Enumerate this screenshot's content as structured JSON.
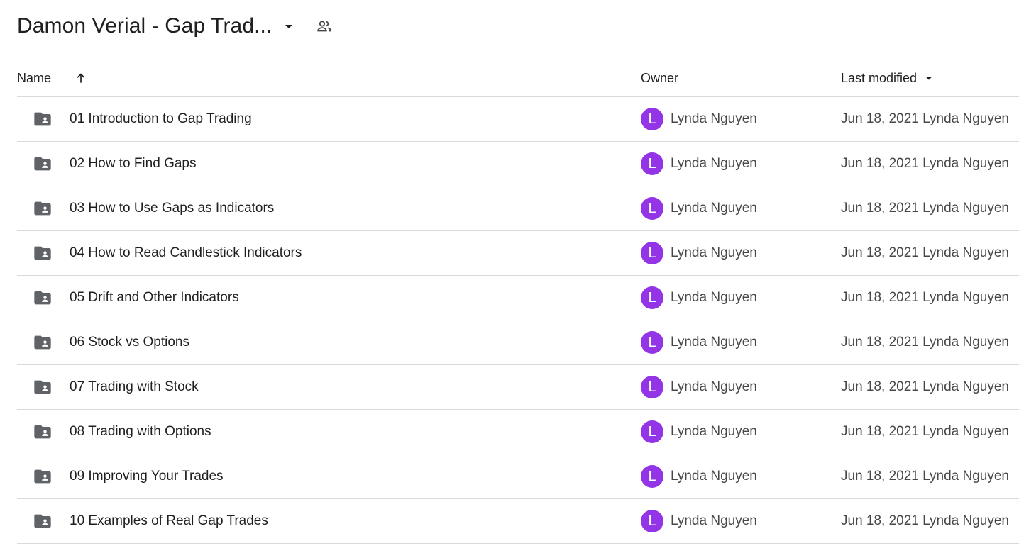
{
  "header": {
    "folder_title": "Damon Verial - Gap Trad...",
    "caret_icon": "arrow-drop-down-icon",
    "shared_icon": "people-icon"
  },
  "columns": {
    "name": "Name",
    "owner": "Owner",
    "last_modified": "Last modified",
    "name_sort": "ascending"
  },
  "colors": {
    "avatar": "#9334e6",
    "folder_icon": "#5f6368",
    "divider": "#dadada"
  },
  "rows": [
    {
      "name": "01 Introduction to Gap Trading",
      "owner_initial": "L",
      "owner": "Lynda Nguyen",
      "modified": "Jun 18, 2021 Lynda Nguyen",
      "icon": "shared-folder-icon"
    },
    {
      "name": "02 How to Find Gaps",
      "owner_initial": "L",
      "owner": "Lynda Nguyen",
      "modified": "Jun 18, 2021 Lynda Nguyen",
      "icon": "shared-folder-icon"
    },
    {
      "name": "03 How to Use Gaps as Indicators",
      "owner_initial": "L",
      "owner": "Lynda Nguyen",
      "modified": "Jun 18, 2021 Lynda Nguyen",
      "icon": "shared-folder-icon"
    },
    {
      "name": "04 How to Read Candlestick Indicators",
      "owner_initial": "L",
      "owner": "Lynda Nguyen",
      "modified": "Jun 18, 2021 Lynda Nguyen",
      "icon": "shared-folder-icon"
    },
    {
      "name": "05 Drift and Other Indicators",
      "owner_initial": "L",
      "owner": "Lynda Nguyen",
      "modified": "Jun 18, 2021 Lynda Nguyen",
      "icon": "shared-folder-icon"
    },
    {
      "name": "06 Stock vs Options",
      "owner_initial": "L",
      "owner": "Lynda Nguyen",
      "modified": "Jun 18, 2021 Lynda Nguyen",
      "icon": "shared-folder-icon"
    },
    {
      "name": "07 Trading with Stock",
      "owner_initial": "L",
      "owner": "Lynda Nguyen",
      "modified": "Jun 18, 2021 Lynda Nguyen",
      "icon": "shared-folder-icon"
    },
    {
      "name": "08 Trading with Options",
      "owner_initial": "L",
      "owner": "Lynda Nguyen",
      "modified": "Jun 18, 2021 Lynda Nguyen",
      "icon": "shared-folder-icon"
    },
    {
      "name": "09 Improving Your Trades",
      "owner_initial": "L",
      "owner": "Lynda Nguyen",
      "modified": "Jun 18, 2021 Lynda Nguyen",
      "icon": "shared-folder-icon"
    },
    {
      "name": "10 Examples of Real Gap Trades",
      "owner_initial": "L",
      "owner": "Lynda Nguyen",
      "modified": "Jun 18, 2021 Lynda Nguyen",
      "icon": "shared-folder-icon"
    }
  ]
}
